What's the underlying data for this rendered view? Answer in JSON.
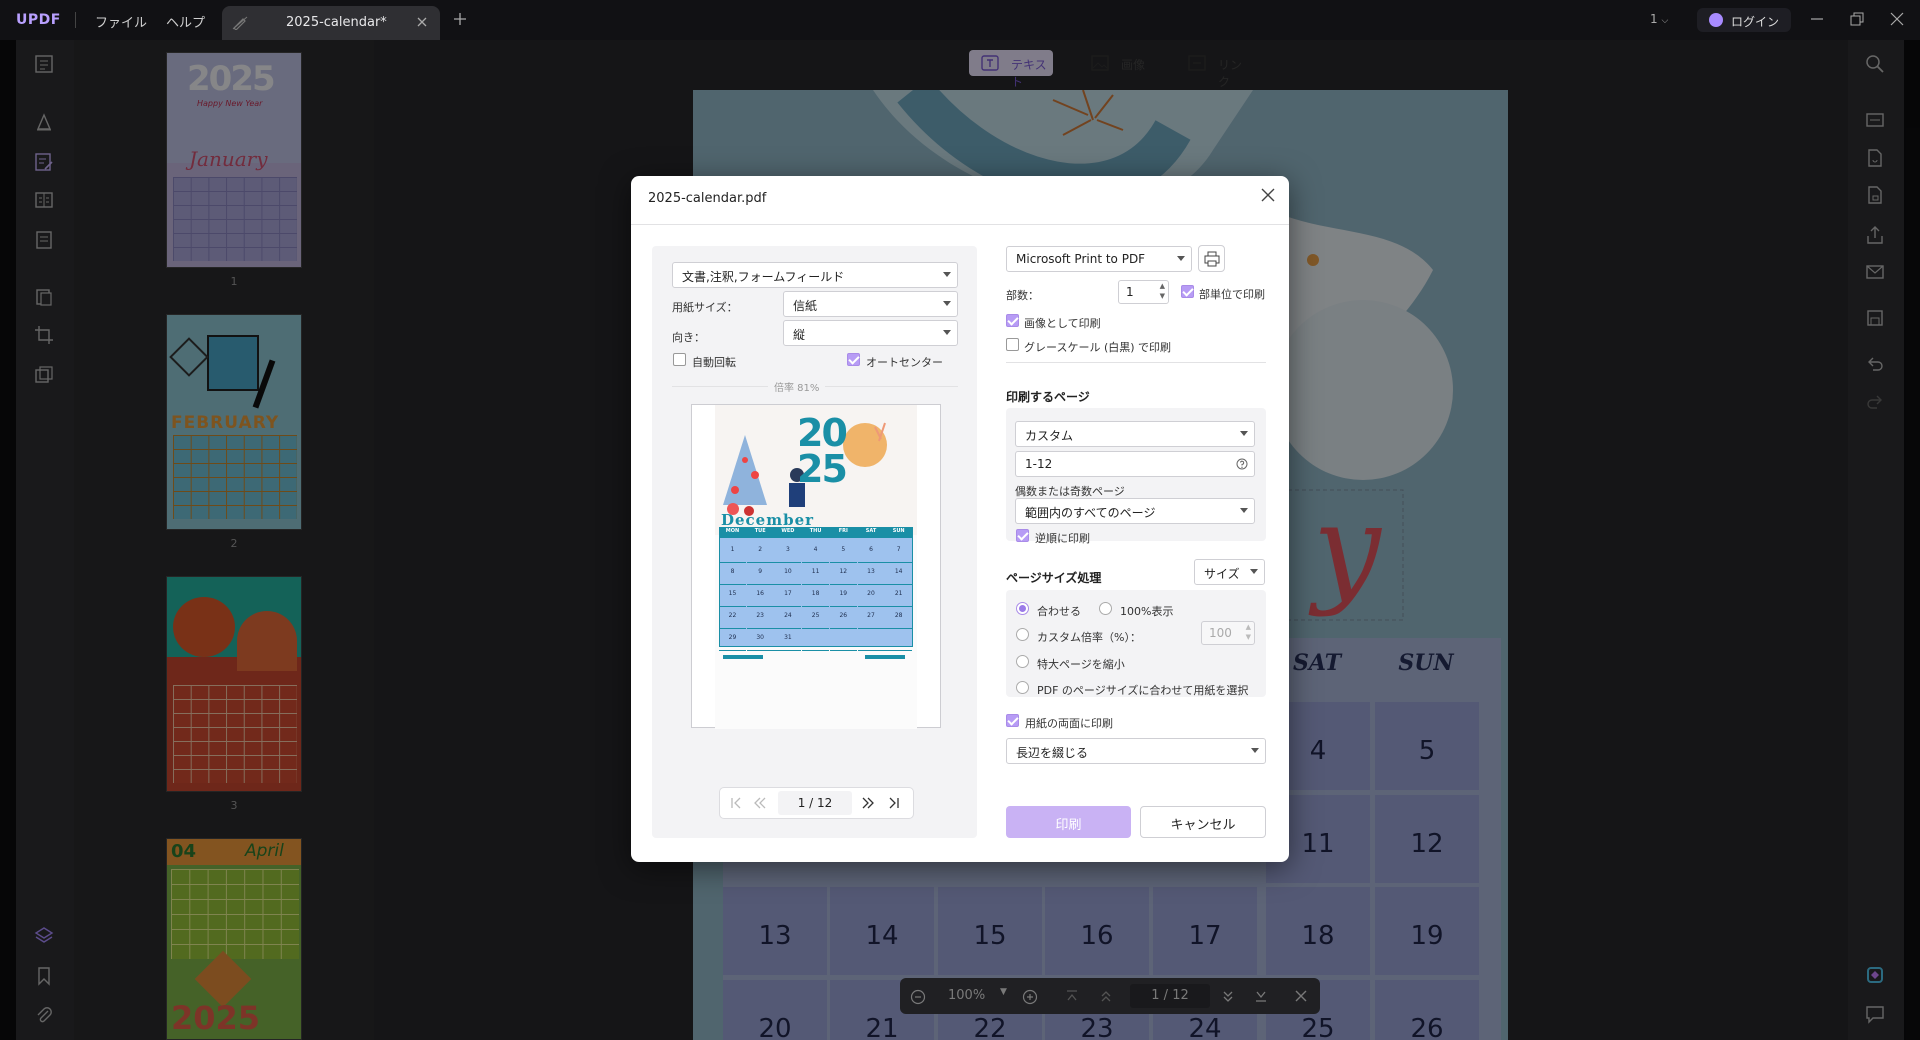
{
  "app": {
    "logo": "UPDF",
    "menu_file": "ファイル",
    "menu_help": "ヘルプ",
    "tab_title": "2025-calendar*",
    "page_selector": "1",
    "login": "ログイン"
  },
  "edit_tabs": {
    "text": "テキスト",
    "image": "画像",
    "link": "リンク"
  },
  "thumbnails": [
    {
      "num": "1",
      "month": "January",
      "year": "2025",
      "subtitle": "Happy New Year"
    },
    {
      "num": "2",
      "month": "FEBRUARY"
    },
    {
      "num": "3",
      "month": ""
    },
    {
      "num": "",
      "month": "April",
      "month_num": "04",
      "year": "2025"
    }
  ],
  "calendar": {
    "script": "y",
    "day_headers": [
      "SAT",
      "SUN"
    ],
    "row1": [
      "4",
      "5"
    ],
    "row2": [
      "11",
      "12"
    ],
    "row3": [
      "13",
      "14",
      "15",
      "16",
      "17",
      "18",
      "19"
    ],
    "row4": [
      "20",
      "21",
      "22",
      "23",
      "24",
      "25",
      "26"
    ]
  },
  "zoom_bar": {
    "zoom": "100%",
    "current_page": "1",
    "sep": "/",
    "total_pages": "12"
  },
  "dialog": {
    "title": "2025-calendar.pdf",
    "content_select": "文書,注釈,フォームフィールド",
    "paper_size_label": "用紙サイズ：",
    "paper_size_value": "信紙",
    "orientation_label": "向き：",
    "orientation_value": "縦",
    "auto_rotate": "自動回転",
    "auto_center": "オートセンター",
    "scale_text": "倍率 81%",
    "preview": {
      "year": "2025",
      "month": "December",
      "days_header": [
        "MON",
        "TUE",
        "WED",
        "THU",
        "FRI",
        "SAT",
        "SUN"
      ],
      "weeks": [
        [
          "1",
          "2",
          "3",
          "4",
          "5",
          "6",
          "7"
        ],
        [
          "8",
          "9",
          "10",
          "11",
          "12",
          "13",
          "14"
        ],
        [
          "15",
          "16",
          "17",
          "18",
          "19",
          "20",
          "21"
        ],
        [
          "22",
          "23",
          "24",
          "25",
          "26",
          "27",
          "28"
        ],
        [
          "29",
          "30",
          "31",
          "",
          "",
          "",
          ""
        ]
      ]
    },
    "nav": {
      "current": "1",
      "sep": "/",
      "total": "12"
    },
    "printer": "Microsoft Print to PDF",
    "copies_label": "部数：",
    "copies_value": "1",
    "collate": "部単位で印刷",
    "print_as_image": "画像として印刷",
    "grayscale": "グレースケール (白黒) で印刷",
    "pages_title": "印刷するページ",
    "pages_mode": "カスタム",
    "pages_range": "1-12",
    "odd_even_label": "偶数または奇数ページ",
    "odd_even_value": "範囲内のすべてのページ",
    "reverse": "逆順に印刷",
    "size_title": "ページサイズ処理",
    "size_select": "サイズ",
    "fit": "合わせる",
    "actual": "100%表示",
    "custom_scale": "カスタム倍率（%）：",
    "custom_scale_value": "100",
    "shrink": "特大ページを縮小",
    "choose_paper": "PDF のページサイズに合わせて用紙を選択",
    "duplex": "用紙の両面に印刷",
    "duplex_mode": "長辺を綴じる",
    "print_button": "印刷",
    "cancel_button": "キャンセル"
  }
}
